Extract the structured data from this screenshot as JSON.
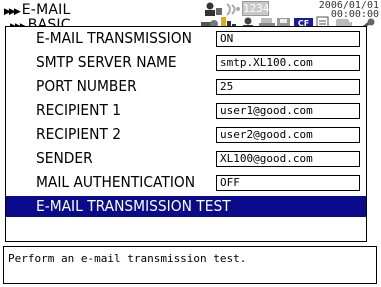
{
  "header": {
    "breadcrumb": [
      "E-MAIL",
      "BASIC"
    ],
    "datetime": [
      "2006/01/01",
      "00:00:00"
    ],
    "memory_indicator": "1234",
    "status_icons": [
      "user-lock-icon",
      "network-icon",
      "memory-icon",
      "printer-icon",
      "disk-icon",
      "cf-card-icon",
      "battery-icon",
      "wrench-icon"
    ]
  },
  "settings": [
    {
      "label": "E-MAIL TRANSMISSION",
      "value": "ON"
    },
    {
      "label": "SMTP SERVER NAME",
      "value": "smtp.XL100.com"
    },
    {
      "label": "PORT NUMBER",
      "value": "25"
    },
    {
      "label": "RECIPIENT 1",
      "value": "user1@good.com"
    },
    {
      "label": "RECIPIENT 2",
      "value": "user2@good.com"
    },
    {
      "label": "SENDER",
      "value": "XL100@good.com"
    },
    {
      "label": "MAIL AUTHENTICATION",
      "value": "OFF"
    }
  ],
  "action": {
    "label": "E-MAIL TRANSMISSION TEST"
  },
  "help_text": "Perform an e-mail transmission test.",
  "colors": {
    "selection": "#0a0a8c",
    "background": "#ffffff",
    "text": "#000000"
  }
}
